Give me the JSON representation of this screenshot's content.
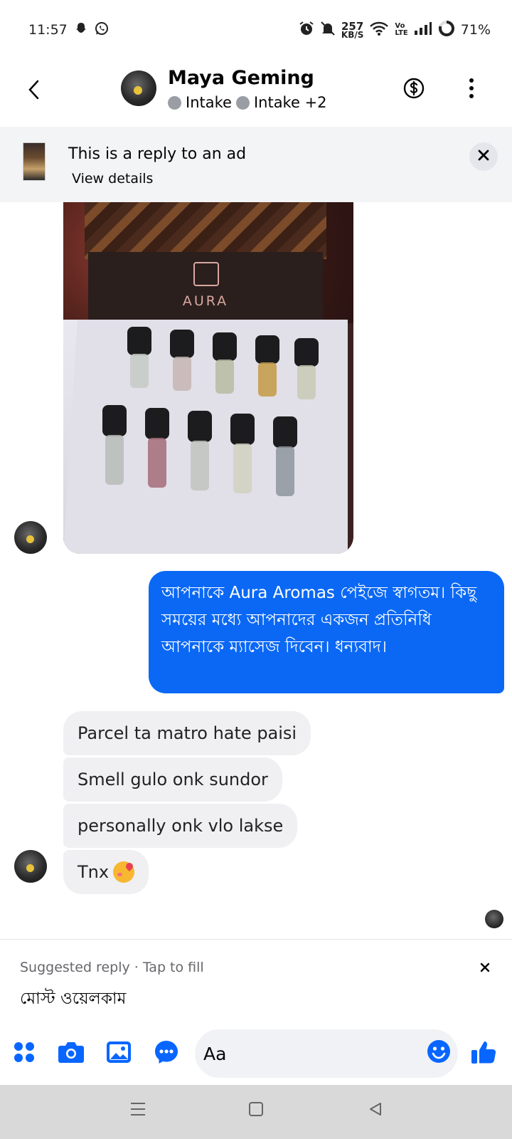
{
  "status_bar": {
    "time": "11:57",
    "net_speed_value": "257",
    "net_speed_unit": "KB/S",
    "volte_top": "Vo",
    "volte_bottom": "LTE",
    "battery": "71%",
    "icons": [
      "snapchat-icon",
      "whatsapp-icon",
      "alarm-icon",
      "mute-icon",
      "wifi-icon",
      "signal-icon",
      "battery-icon"
    ]
  },
  "header": {
    "back_icon": "chevron-left-icon",
    "name": "Maya Geming",
    "labels": [
      "Intake",
      "Intake +2"
    ],
    "actions": [
      "dollar-icon",
      "more-vertical-icon"
    ]
  },
  "ad_banner": {
    "title": "This is a reply to an ad",
    "link": "View details"
  },
  "messages": {
    "photo_brand": "AURA",
    "outgoing": "আপনাকে Aura Aromas পেইজে স্বাগতম। কিছু সময়ের মধ্যে আপনাদের একজন প্রতিনিধি আপনাকে ম্যাসেজ দিবেন। ধন্যবাদ।",
    "incoming": [
      "Parcel ta matro hate paisi",
      "Smell gulo onk sundor",
      "personally onk vlo lakse",
      "Tnx"
    ]
  },
  "suggested_reply": {
    "caption": "Suggested reply · Tap to fill",
    "text": "মোস্ট ওয়েলকাম"
  },
  "composer": {
    "placeholder": "Aa",
    "icons": [
      "apps-icon",
      "camera-icon",
      "gallery-icon",
      "chat-icon",
      "emoji-icon",
      "like-icon"
    ]
  },
  "colors": {
    "accent": "#0a68f5",
    "bubble_in": "#f0f0f3",
    "icon_blue": "#0866ff"
  }
}
